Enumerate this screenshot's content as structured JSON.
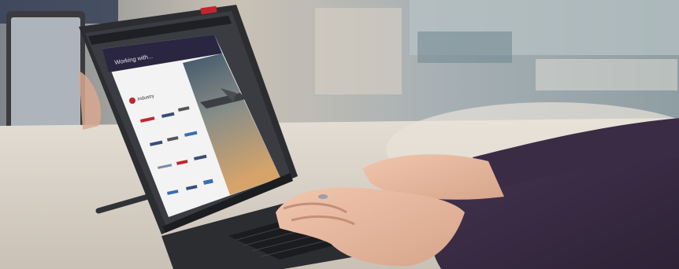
{
  "slide": {
    "heading": "Working with...",
    "section_label": "Industry"
  },
  "logos": [
    "",
    "",
    "",
    "",
    "",
    "",
    "",
    "",
    "",
    "",
    "",
    ""
  ],
  "colors": {
    "slide_header": "#2a2541",
    "slide_accent": "#c2262e",
    "sweater": "#3b2c45",
    "desk": "#d8d2c9",
    "laptop_body": "#2b2d31"
  }
}
